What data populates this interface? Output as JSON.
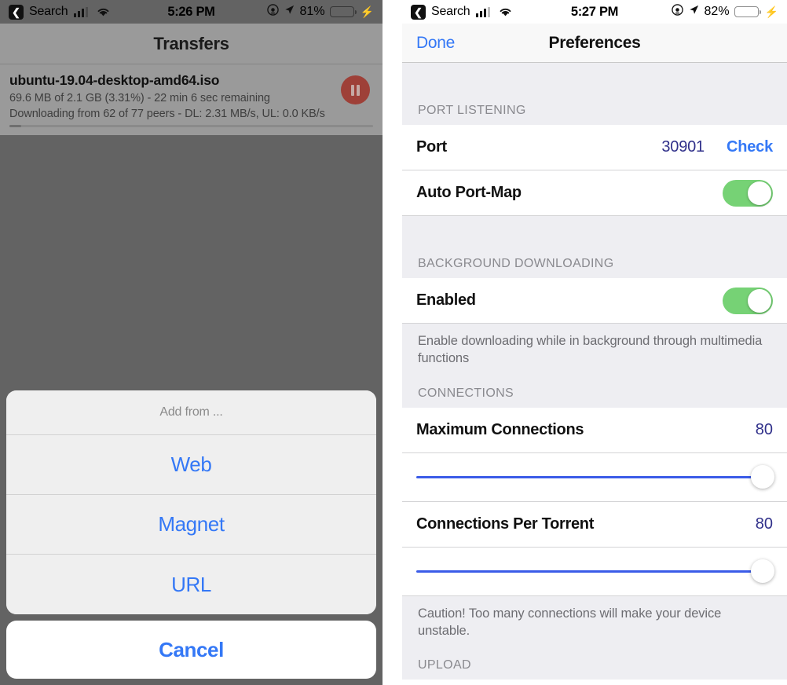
{
  "left": {
    "status_bar": {
      "back_icon": "back-chevron-icon",
      "carrier": "Search",
      "signal_icon": "cellular-bars-icon",
      "wifi_icon": "wifi-icon",
      "time": "5:26 PM",
      "alarm_icon": "orientation-lock-icon",
      "location_icon": "location-arrow-icon",
      "battery_percent": "81%",
      "battery_level": 81,
      "charging_icon": "lightning-bolt-icon"
    },
    "nav": {
      "title": "Transfers"
    },
    "transfer": {
      "name": "ubuntu-19.04-desktop-amd64.iso",
      "progress_line": "69.6 MB of 2.1 GB (3.31%) - 22 min 6 sec remaining",
      "peers_line": "Downloading from 62 of 77 peers - DL: 2.31 MB/s, UL: 0.0 KB/s",
      "percent": 3.31,
      "pause_icon": "pause-icon"
    },
    "action_sheet": {
      "title": "Add from ...",
      "items": [
        {
          "label": "Web"
        },
        {
          "label": "Magnet"
        },
        {
          "label": "URL"
        }
      ],
      "cancel_label": "Cancel"
    }
  },
  "right": {
    "status_bar": {
      "back_icon": "back-chevron-icon",
      "carrier": "Search",
      "signal_icon": "cellular-bars-icon",
      "wifi_icon": "wifi-icon",
      "time": "5:27 PM",
      "alarm_icon": "orientation-lock-icon",
      "location_icon": "location-arrow-icon",
      "battery_percent": "82%",
      "battery_level": 82,
      "charging_icon": "lightning-bolt-icon"
    },
    "nav": {
      "done_label": "Done",
      "title": "Preferences"
    },
    "sections": {
      "port_listening": {
        "header": "PORT LISTENING",
        "port_label": "Port",
        "port_value": "30901",
        "check_label": "Check",
        "auto_port_map_label": "Auto Port-Map",
        "auto_port_map_on": true
      },
      "background_downloading": {
        "header": "BACKGROUND DOWNLOADING",
        "enabled_label": "Enabled",
        "enabled_on": true,
        "note": "Enable downloading while in background through multimedia functions"
      },
      "connections": {
        "header": "CONNECTIONS",
        "max_connections_label": "Maximum Connections",
        "max_connections_value": "80",
        "max_connections_pct": 100,
        "per_torrent_label": "Connections Per Torrent",
        "per_torrent_value": "80",
        "per_torrent_pct": 100,
        "note": "Caution! Too many connections will make your device unstable."
      },
      "upload": {
        "header": "UPLOAD"
      }
    }
  },
  "colors": {
    "accent_blue": "#3478f6",
    "toggle_green": "#76d275",
    "slider_blue": "#3b5ce8",
    "pause_red": "#9e4038"
  }
}
